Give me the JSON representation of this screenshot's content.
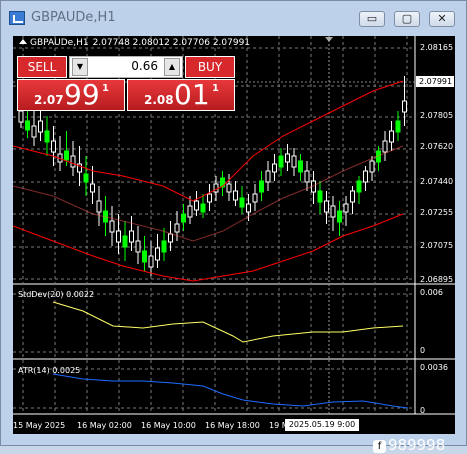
{
  "window": {
    "title": "GBPAUDe,H1",
    "buttons": {
      "minimize": "▭",
      "restore": "▢",
      "close": "✕"
    }
  },
  "chart": {
    "symbol": "GBPAUDe,H1",
    "ohlc": "2.07748 2.08012 2.07706 2.07991",
    "price_labels": [
      "2.08165",
      "2.07805",
      "2.07620",
      "2.07440",
      "2.07255",
      "2.07075",
      "2.06895"
    ],
    "current_price": "2.07991",
    "time_labels": [
      "15 May 2025",
      "16 May 02:00",
      "16 May 10:00",
      "16 May 18:00",
      "19 M"
    ],
    "cursor_time": "2025.05.19 9:00",
    "colors": {
      "bull": "#ffffff",
      "bear": "#00ff00",
      "bands": "#ff0000",
      "stddev": "#ffff66",
      "atr": "#1e6cff",
      "grid": "#7a7a7a"
    }
  },
  "trade": {
    "sell_label": "SELL",
    "buy_label": "BUY",
    "lot_value": "0.66",
    "lot_dec_icon": "▼",
    "lot_inc_icon": "▲",
    "sell_price": {
      "small": "2.07",
      "big": "99",
      "tiny": "1"
    },
    "buy_price": {
      "small": "2.08",
      "big": "01",
      "tiny": "1"
    }
  },
  "indicators": {
    "stddev": {
      "label": "StdDev(20) 0.0022",
      "max": "0.006",
      "min": "0"
    },
    "atr": {
      "label": "ATR(14) 0.0025",
      "max": "0.0036",
      "min": "0"
    }
  },
  "watermark": {
    "badge": "f",
    "text": "989998"
  }
}
